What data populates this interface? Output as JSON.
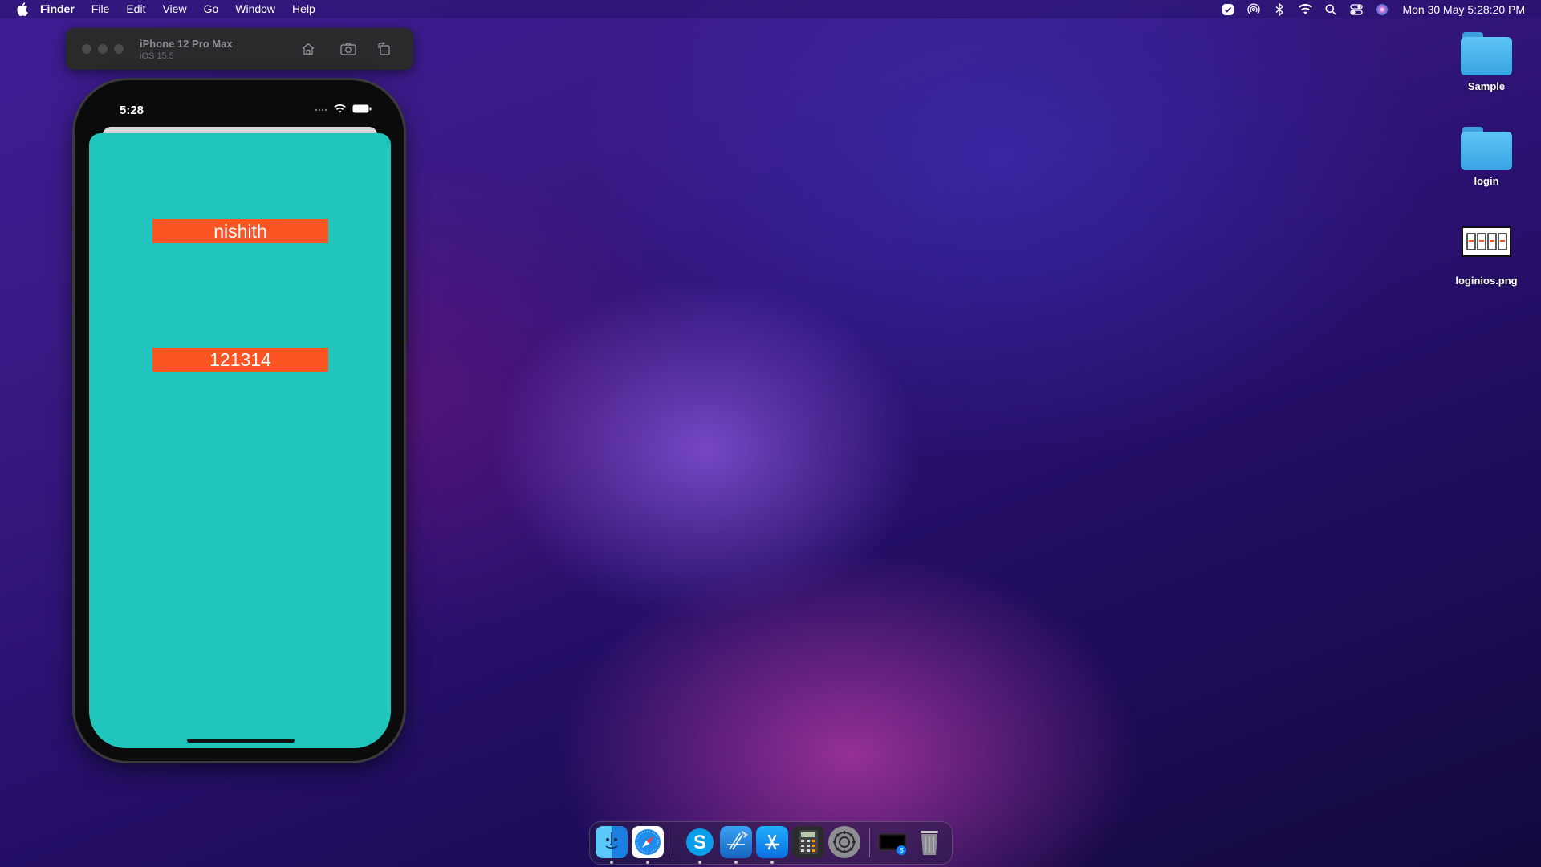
{
  "menubar": {
    "app_name": "Finder",
    "menus": [
      "File",
      "Edit",
      "View",
      "Go",
      "Window",
      "Help"
    ],
    "status_icons": [
      "checkmark-badge-icon",
      "airdrop-icon",
      "bluetooth-icon",
      "wifi-icon",
      "spotlight-search-icon",
      "control-center-icon",
      "siri-icon"
    ],
    "clock": "Mon 30 May  5:28:20 PM"
  },
  "simulator": {
    "device_name": "iPhone 12 Pro Max",
    "os_version": "iOS 15.5",
    "toolbar_buttons": [
      "home-icon",
      "screenshot-camera-icon",
      "rotate-icon"
    ]
  },
  "phone": {
    "status_time": "5:28",
    "fields": {
      "username": "nishith",
      "password": "121314"
    },
    "screen_color": "#20c6bb",
    "field_color": "#fd5423"
  },
  "desktop": {
    "items": [
      {
        "label": "Sample",
        "kind": "folder"
      },
      {
        "label": "login",
        "kind": "folder"
      },
      {
        "label": "loginios.png",
        "kind": "image"
      }
    ]
  },
  "dock": {
    "apps": [
      "finder-icon",
      "safari-icon",
      "skype-icon",
      "xcode-icon",
      "app-store-icon",
      "calculator-icon",
      "system-preferences-icon",
      "simulator-icon",
      "trash-icon"
    ]
  }
}
